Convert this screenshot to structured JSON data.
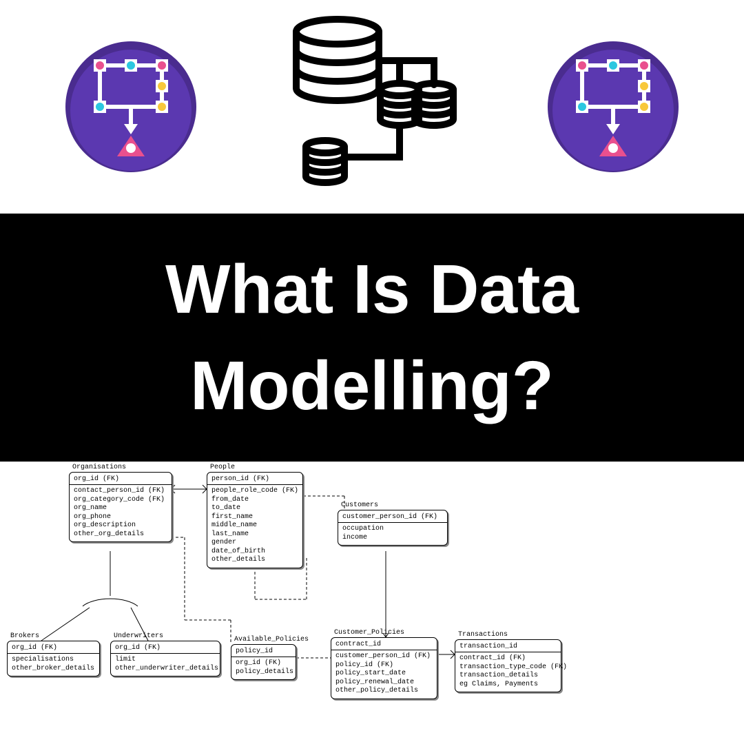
{
  "title": "What Is Data Modelling?",
  "entities": {
    "organisations": {
      "name": "Organisations",
      "pk": "org_id (FK)",
      "fields": [
        "contact_person_id (FK)",
        "org_category_code (FK)",
        "org_name",
        "org_phone",
        "org_description",
        "other_org_details"
      ]
    },
    "people": {
      "name": "People",
      "pk": "person_id (FK)",
      "fields": [
        "people_role_code (FK)",
        "from_date",
        "to_date",
        "first_name",
        "middle_name",
        "last_name",
        "gender",
        "date_of_birth",
        "other_details"
      ]
    },
    "customers": {
      "name": "Customers",
      "pk": "customer_person_id (FK)",
      "fields": [
        "occupation",
        "income"
      ]
    },
    "brokers": {
      "name": "Brokers",
      "pk": "org_id (FK)",
      "fields": [
        "specialisations",
        "other_broker_details"
      ]
    },
    "underwriters": {
      "name": "Underwriters",
      "pk": "org_id (FK)",
      "fields": [
        "limit",
        "other_underwriter_details"
      ]
    },
    "available_policies": {
      "name": "Available_Policies",
      "pk": "policy_id",
      "fields": [
        "org_id (FK)",
        "policy_details"
      ]
    },
    "customer_policies": {
      "name": "Customer_Policies",
      "pk": "contract_id",
      "fields": [
        "customer_person_id (FK)",
        "policy_id (FK)",
        "policy_start_date",
        "policy_renewal_date",
        "other_policy_details"
      ]
    },
    "transactions": {
      "name": "Transactions",
      "pk": "transaction_id",
      "fields": [
        "contract_id (FK)",
        "transaction_type_code (FK)",
        "transaction_details",
        "eg Claims, Payments"
      ]
    }
  }
}
